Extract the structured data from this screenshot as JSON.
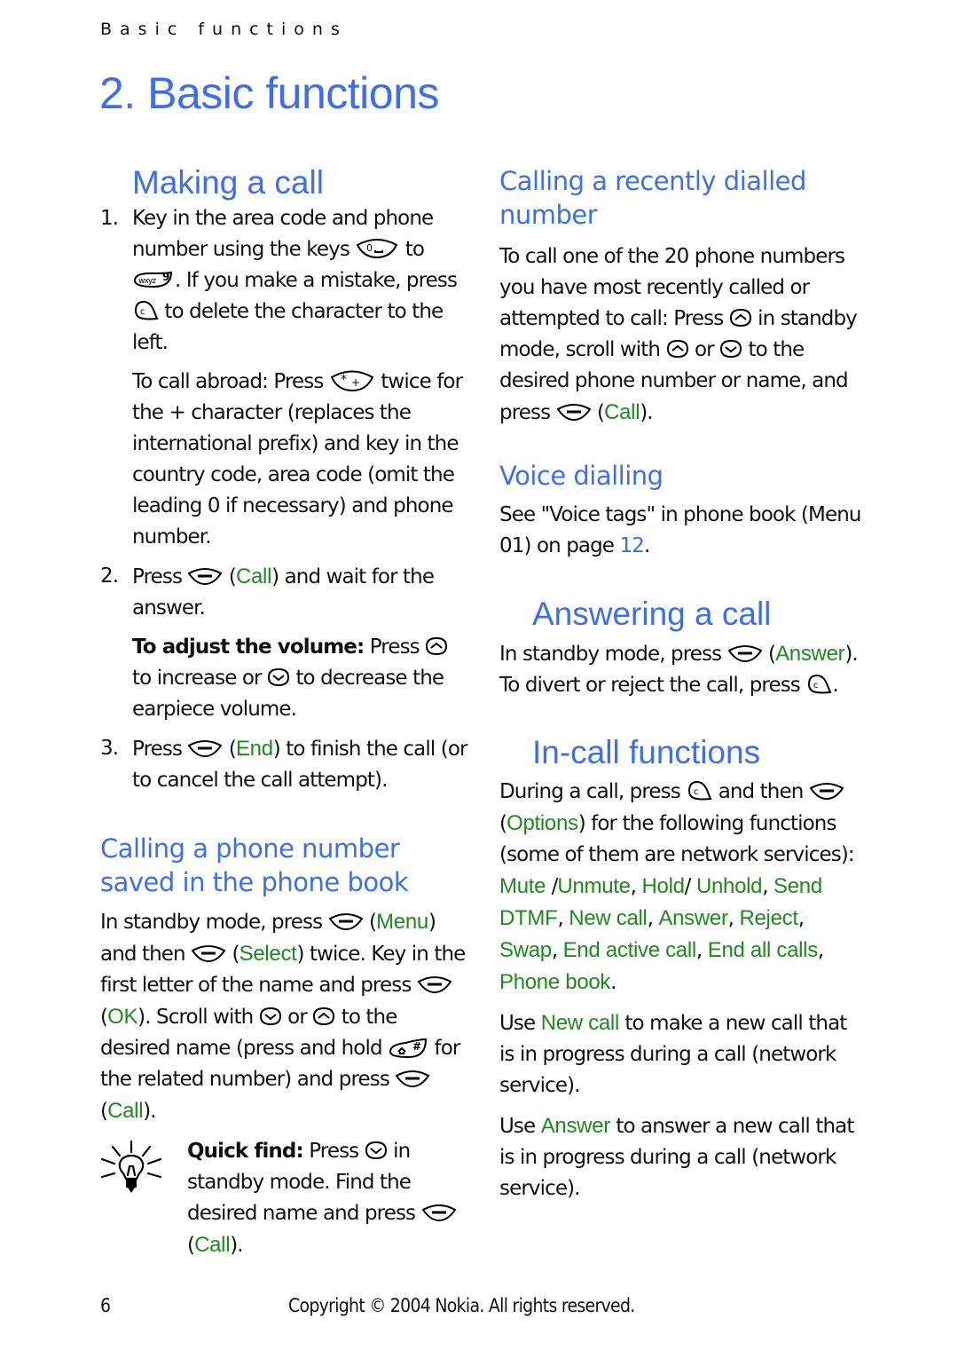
{
  "header": {
    "running_head": "Basic functions",
    "chapter_title": "2. Basic functions"
  },
  "making_call": {
    "title": "Making a call",
    "step1": {
      "num": "1.",
      "t1": "Key in the area code and phone number using the keys",
      "t2": "to",
      "t3": ". If you make a mistake, press",
      "t4": "to delete the character to the left."
    },
    "abroad": {
      "t1": "To call abroad: Press",
      "t2": "twice for the + character (replaces the international prefix) and key in the country code, area code (omit the leading 0 if necessary) and phone number."
    },
    "step2": {
      "num": "2.",
      "t1": "Press",
      "softkey": "Call",
      "t2": "and wait for the answer."
    },
    "volume": {
      "label": "To adjust the volume:",
      "t1": "Press",
      "t2": "to increase or",
      "t3": "to decrease the earpiece volume."
    },
    "step3": {
      "num": "3.",
      "t1": "Press",
      "softkey": "End",
      "t2": "to finish the call (or to cancel the call attempt)."
    }
  },
  "phone_book_call": {
    "title": "Calling a phone number saved in the phone book",
    "t1": "In standby mode, press",
    "menu": "Menu",
    "t2": "and then",
    "select": "Select",
    "t3": "twice. Key in the first letter of the name and press",
    "ok": "OK",
    "t4": ". Scroll with",
    "t5": "or",
    "t6": "to the desired name (press and hold",
    "t7": "for the related number) and press",
    "call": "Call",
    "t8": ").",
    "tip": {
      "label": "Quick find:",
      "t1": "Press",
      "t2": "in standby mode. Find the desired name and press",
      "call": "Call",
      "t3": ")."
    }
  },
  "recent_call": {
    "title": "Calling a recently dialled number",
    "t1": "To call one of the 20 phone numbers you have most recently called or attempted to call: Press",
    "t2": "in standby mode, scroll with",
    "t3": "or",
    "t4": "to the desired phone number or name, and press",
    "call": "Call",
    "t5": ")."
  },
  "voice_dialling": {
    "title": "Voice dialling",
    "t1": "See \"Voice tags\" in phone book (Menu 01) on page",
    "page_link": "12",
    "t2": "."
  },
  "answering": {
    "title": "Answering a call",
    "t1": "In standby mode, press",
    "answer": "Answer",
    "t2": "). To divert or reject the call, press",
    "t3": "."
  },
  "in_call": {
    "title": "In-call functions",
    "t1": "During a call, press",
    "t2": "and then",
    "options": "Options",
    "t3": ") for the following functions (some of them are network services):",
    "functions": [
      "Mute",
      "Unmute",
      "Hold",
      "Unhold",
      "Send DTMF",
      "New call",
      "Answer",
      "Reject",
      "Swap",
      "End active call",
      "End all calls",
      "Phone book"
    ],
    "new_call_para": {
      "t1": "Use",
      "term": "New call",
      "t2": "to make a new call that is in progress during a call (network service)."
    },
    "answer_para": {
      "t1": "Use",
      "term": "Answer",
      "t2": "to answer a new call that is in progress during a call (network service)."
    }
  },
  "footer": {
    "page_number": "6",
    "copyright": "Copyright © 2004 Nokia. All rights reserved."
  },
  "colors": {
    "heading": "#3d6ef0",
    "softkey_text": "#1e8a1e",
    "body": "#111111"
  },
  "icons": {
    "selection_key": "selection-key-icon",
    "clear_key": "c-key-icon",
    "scroll_up": "scroll-up-icon",
    "scroll_down": "scroll-down-icon",
    "key_0": "zero-key-icon",
    "key_9": "nine-key-icon",
    "key_star": "star-key-icon",
    "key_hash": "hash-key-icon",
    "tip": "lightbulb-tip-icon"
  }
}
